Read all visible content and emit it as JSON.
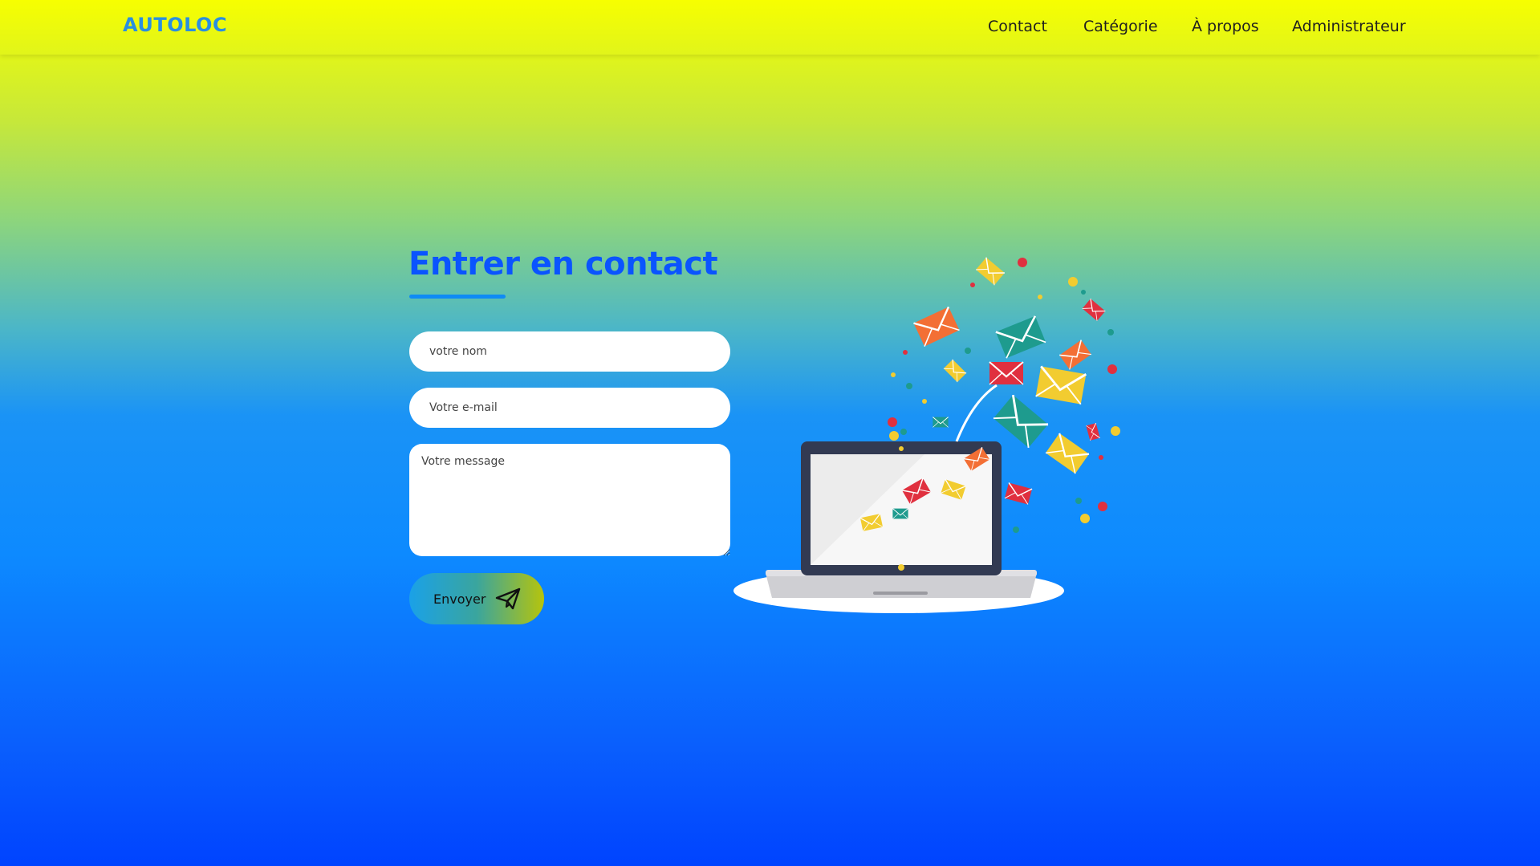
{
  "header": {
    "logo": "AUTOLOC",
    "nav": [
      {
        "label": "Contact"
      },
      {
        "label": "Catégorie"
      },
      {
        "label": "À propos"
      },
      {
        "label": "Administrateur"
      }
    ]
  },
  "contact": {
    "title": "Entrer en contact",
    "name_placeholder": "votre nom",
    "email_placeholder": "Votre e-mail",
    "message_placeholder": "Votre message",
    "submit_label": "Envoyer",
    "submit_icon": "paper-plane-icon"
  },
  "illustration": {
    "name": "laptop-with-flying-envelopes-illustration",
    "colors": {
      "yellow": "#f2cc30",
      "teal": "#1e9b8e",
      "red": "#e0303f",
      "orange": "#f36f35",
      "laptop_frame": "#323a52",
      "screen": "#ececec"
    }
  },
  "theme": {
    "gradient_top": "#f7ff00",
    "gradient_bottom": "#0043ff",
    "accent": "#0a54ff",
    "logo_color": "#2a8fe0"
  }
}
